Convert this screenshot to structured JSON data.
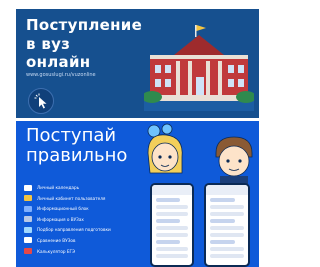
{
  "banner_top": {
    "title_lines": [
      "Поступление",
      "в вуз",
      "онлайн"
    ],
    "url": "www.gosuslugi.ru/vuzonline",
    "cursor_icon": "cursor-click-icon",
    "illustration": "university-building-icon",
    "colors": {
      "background": "#16508f",
      "building": "#c0393b"
    }
  },
  "banner_bottom": {
    "title_lines": [
      "Поступай",
      "правильно"
    ],
    "menu_items": [
      {
        "label": "Личный календарь",
        "icon": "calendar-icon",
        "color": "#ffffff"
      },
      {
        "label": "Личный кабинет пользователя",
        "icon": "user-icon",
        "color": "#f4c542"
      },
      {
        "label": "Информационный блок",
        "icon": "info-icon",
        "color": "#7fb0ff"
      },
      {
        "label": "Информация о ВУЗах",
        "icon": "university-icon",
        "color": "#b9c9e6"
      },
      {
        "label": "Подбор направления подготовки",
        "icon": "direction-icon",
        "color": "#9fd7ff"
      },
      {
        "label": "Сравнение ВУЗов",
        "icon": "compare-icon",
        "color": "#ffffff"
      },
      {
        "label": "Калькулятор ЕГЭ",
        "icon": "calculator-icon",
        "color": "#e54848"
      }
    ],
    "illustration": "students-with-phones-icon",
    "colors": {
      "background": "#0f5ad9"
    }
  }
}
